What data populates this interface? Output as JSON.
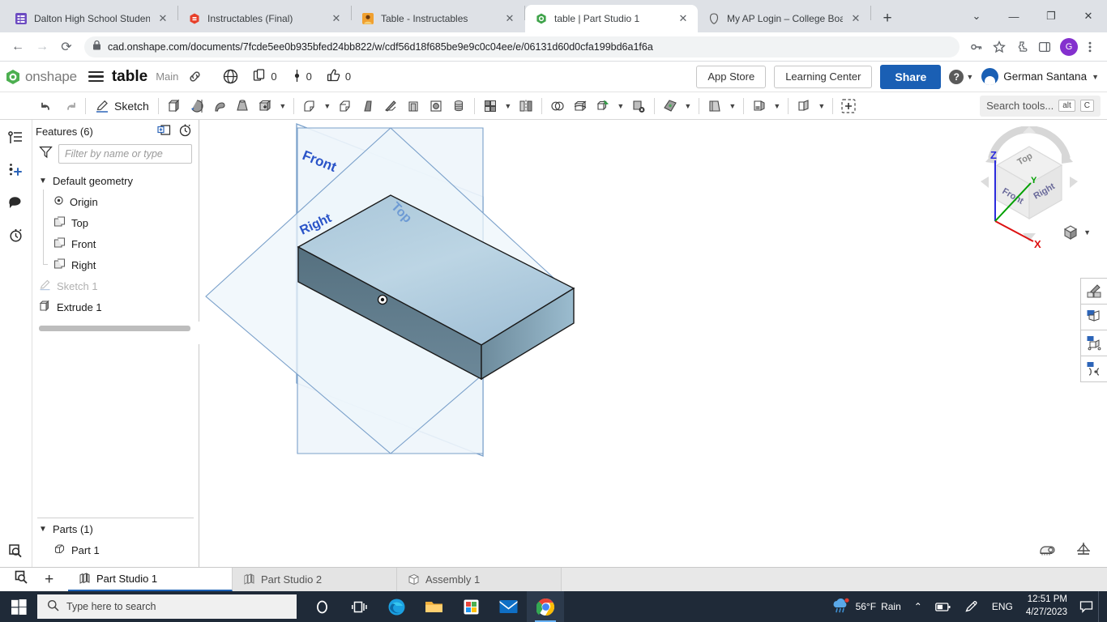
{
  "browser": {
    "tabs": [
      {
        "title": "Dalton High School Student C",
        "favicon": "grid-purple-icon",
        "active": false
      },
      {
        "title": "Instructables (Final)",
        "favicon": "instructables-icon",
        "active": false
      },
      {
        "title": "Table - Instructables",
        "favicon": "person-icon",
        "active": false
      },
      {
        "title": "table | Part Studio 1",
        "favicon": "onshape-icon",
        "active": true
      },
      {
        "title": "My AP Login – College Board",
        "favicon": "collegeboard-icon",
        "active": false
      }
    ],
    "new_tab_label": "+",
    "close_label": "✕",
    "window_controls": {
      "minimize": "—",
      "maximize": "❐",
      "close": "✕",
      "tablist": "⌄"
    },
    "nav": {
      "back": "←",
      "forward": "→",
      "reload": "⟳"
    },
    "url": "cad.onshape.com/documents/7fcde5ee0b935bfed24bb822/w/cdf56d18f685be9e9c0c04ee/e/06131d60d0cfa199bd6a1f6a",
    "url_host": "cad.onshape.com",
    "url_path": "/documents/7fcde5ee0b935bfed24bb822/w/cdf56d18f685be9e9c0c04ee/e/06131d60d0cfa199bd6a1f6a",
    "profile_initial": "G",
    "toolbar_icons": [
      "key-icon",
      "star-icon",
      "extensions-icon",
      "sidepanel-icon",
      "menu-icon"
    ]
  },
  "onshape": {
    "logo_text": "onshape",
    "document_title": "table",
    "branch": "Main",
    "counters": [
      {
        "icon": "copy-icon",
        "value": "0"
      },
      {
        "icon": "versions-icon",
        "value": "0"
      },
      {
        "icon": "thumbsup-icon",
        "value": "0"
      }
    ],
    "app_store": "App Store",
    "learning_center": "Learning Center",
    "share": "Share",
    "help": "?",
    "user_name": "German Santana",
    "toolbar": {
      "undo": "↶",
      "redo": "↷",
      "sketch": "Sketch",
      "search_placeholder": "Search tools...",
      "search_kbd_alt": "alt",
      "search_kbd_key": "C",
      "tools": [
        "extrude-icon",
        "revolve-icon",
        "sweep-icon",
        "loft-icon",
        "thicken-icon",
        "fillet-icon",
        "chamfer-icon",
        "draft-icon",
        "rib-icon",
        "shell-icon",
        "hole-icon",
        "thread-icon",
        "pattern-icon",
        "mirror-icon",
        "boolean-icon",
        "split-icon",
        "transform-icon",
        "delete-face-icon",
        "plane-icon",
        "sketch-plane-icon",
        "derived-icon",
        "composite-part-icon",
        "add-custom-feature-icon"
      ]
    },
    "rail_icons": [
      "feature-list-icon",
      "insert-icon",
      "comments-icon",
      "history-icon",
      "zoom-icon"
    ],
    "feature_tree": {
      "header": "Features (6)",
      "header_icons": [
        "add-folder-icon",
        "rollback-timer-icon"
      ],
      "filter_placeholder": "Filter by name or type",
      "filter_value": "",
      "default_geometry_label": "Default geometry",
      "default_geometry_items": [
        {
          "label": "Origin",
          "icon": "origin-icon"
        },
        {
          "label": "Top",
          "icon": "plane-icon"
        },
        {
          "label": "Front",
          "icon": "plane-icon"
        },
        {
          "label": "Right",
          "icon": "plane-icon"
        }
      ],
      "features": [
        {
          "label": "Sketch 1",
          "icon": "sketch-icon",
          "dimmed": true
        },
        {
          "label": "Extrude 1",
          "icon": "extrude-icon",
          "dimmed": false
        }
      ],
      "parts_header": "Parts (1)",
      "parts": [
        {
          "label": "Part 1",
          "icon": "part-icon"
        }
      ]
    },
    "viewport": {
      "plane_labels": [
        "Front",
        "Top",
        "Right"
      ],
      "viewcube": {
        "faces": [
          "Top",
          "Front",
          "Right"
        ],
        "axes": [
          {
            "label": "Z",
            "color": "#2b2bdd"
          },
          {
            "label": "Y",
            "color": "#00a000"
          },
          {
            "label": "X",
            "color": "#dd1111"
          }
        ]
      },
      "right_tools": [
        "appearance-icon",
        "render-icon",
        "transform-render-icon",
        "measure-render-icon"
      ],
      "bottom_tools": [
        "measure-tape-icon",
        "mass-properties-icon"
      ],
      "display_style": "shaded-icon"
    },
    "bottom_tabs": [
      {
        "label": "Part Studio 1",
        "icon": "part-studio-icon",
        "active": true
      },
      {
        "label": "Part Studio 2",
        "icon": "part-studio-icon",
        "active": false
      },
      {
        "label": "Assembly 1",
        "icon": "assembly-icon",
        "active": false
      }
    ],
    "add_tab": "+",
    "tab_search_icon": "tab-search-icon"
  },
  "taskbar": {
    "start_icon": "windows-icon",
    "search_placeholder": "Type here to search",
    "apps": [
      "cortana-icon",
      "task-view-icon",
      "edge-icon",
      "file-explorer-icon",
      "microsoft-store-icon",
      "mail-icon",
      "chrome-icon"
    ],
    "weather_temp": "56°F",
    "weather_cond": "Rain",
    "chevron": "⌃",
    "tray_icons": [
      "battery-icon",
      "pen-icon"
    ],
    "language": "ENG",
    "time": "12:51 PM",
    "date": "4/27/2023",
    "notification_icon": "notification-icon"
  }
}
